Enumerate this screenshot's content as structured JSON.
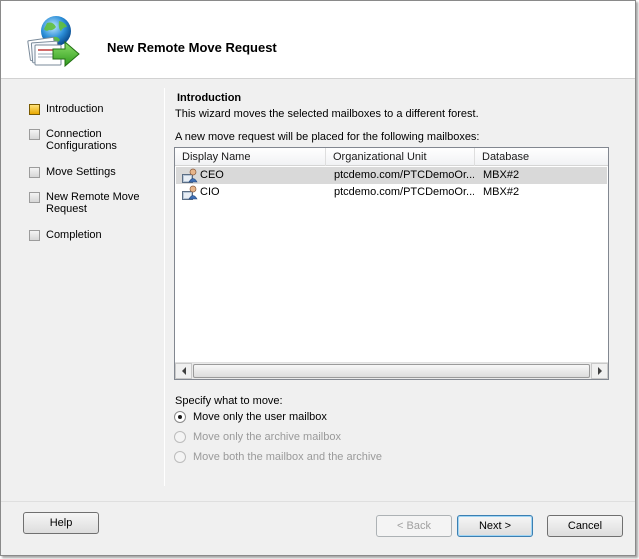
{
  "wizard": {
    "title": "New Remote Move Request"
  },
  "steps": [
    {
      "label": "Introduction",
      "current": true
    },
    {
      "label": "Connection Configurations",
      "current": false
    },
    {
      "label": "Move Settings",
      "current": false
    },
    {
      "label": "New Remote Move Request",
      "current": false
    },
    {
      "label": "Completion",
      "current": false
    }
  ],
  "content": {
    "title": "Introduction",
    "description": "This wizard moves the selected mailboxes to a different forest.",
    "mailbox_note": "A new move request will be placed for the following mailboxes:"
  },
  "mailbox_table": {
    "columns": [
      "Display Name",
      "Organizational Unit",
      "Database"
    ],
    "rows": [
      {
        "display_name": "CEO",
        "ou": "ptcdemo.com/PTCDemoOr...",
        "database": "MBX#2",
        "selected": true
      },
      {
        "display_name": "CIO",
        "ou": "ptcdemo.com/PTCDemoOr...",
        "database": "MBX#2",
        "selected": false
      }
    ]
  },
  "move_options": {
    "label": "Specify what to move:",
    "options": [
      {
        "label": "Move only the user mailbox",
        "checked": true,
        "disabled": false
      },
      {
        "label": "Move only the archive mailbox",
        "checked": false,
        "disabled": true
      },
      {
        "label": "Move both the mailbox and the archive",
        "checked": false,
        "disabled": true
      }
    ]
  },
  "buttons": {
    "help": "Help",
    "back": "< Back",
    "next": "Next >",
    "cancel": "Cancel"
  },
  "colors": {
    "current_step": "#e8a800",
    "selected_row": "#d9d9d9",
    "dialog_bg": "#f0f0f0"
  },
  "icons": {
    "header": "move-mailbox-globe-icon",
    "row": "user-mailbox-icon"
  }
}
